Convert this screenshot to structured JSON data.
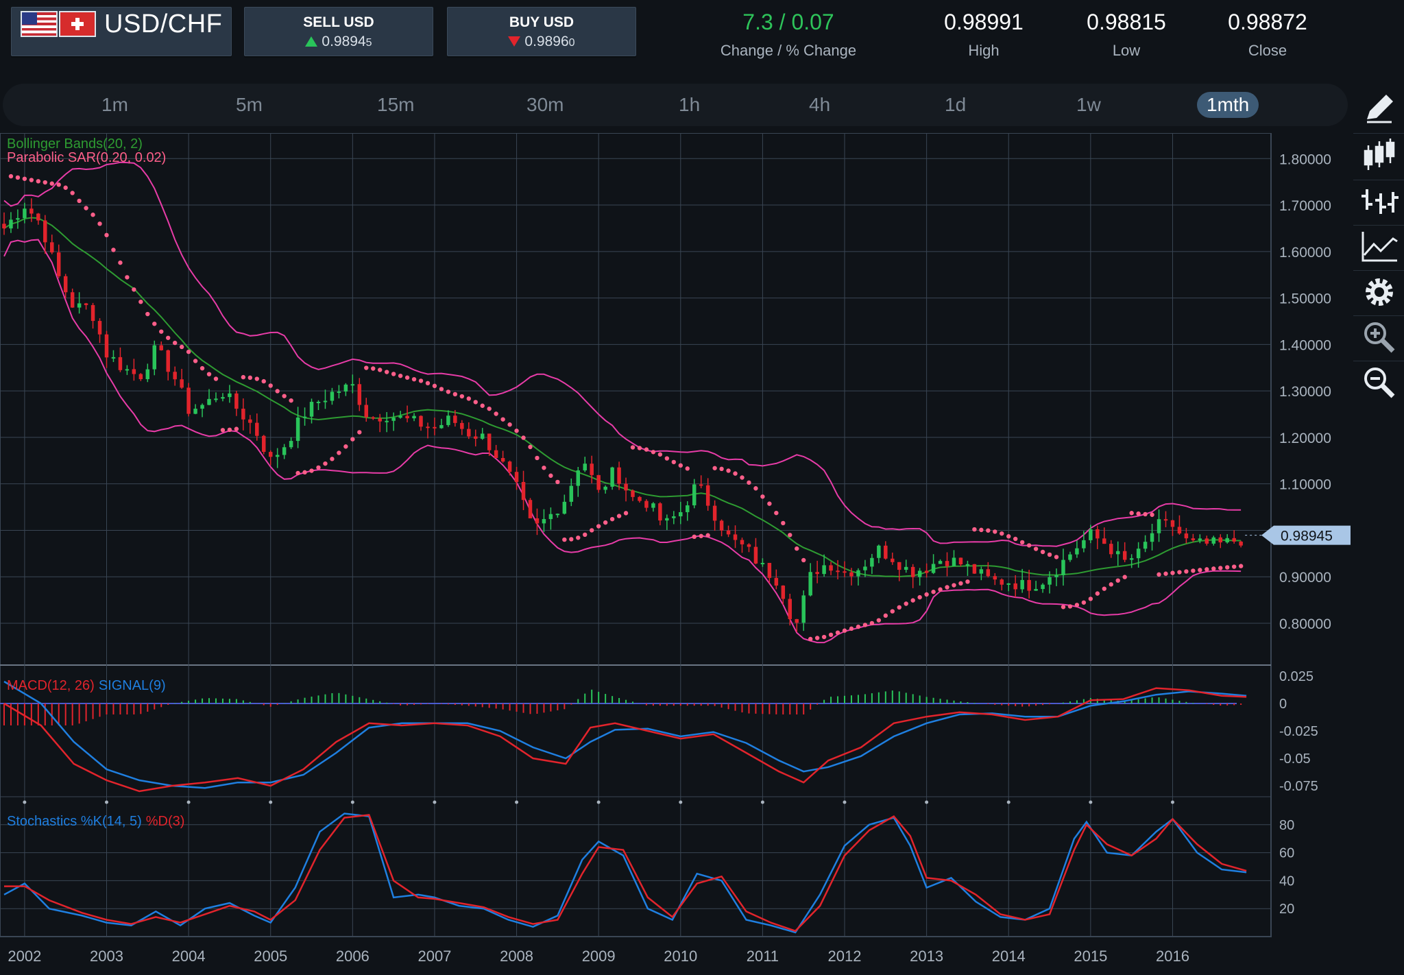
{
  "header": {
    "pair": "USD/CHF",
    "sell": {
      "label": "SELL USD",
      "price_main": "0.9894",
      "price_pip": "5",
      "direction": "up"
    },
    "buy": {
      "label": "BUY USD",
      "price_main": "0.9896",
      "price_pip": "0",
      "direction": "down"
    },
    "stats": [
      {
        "value": "7.3 / 0.07",
        "label": "Change / % Change",
        "color": "#2ec45a"
      },
      {
        "value": "0.98991",
        "label": "High"
      },
      {
        "value": "0.98815",
        "label": "Low"
      },
      {
        "value": "0.98872",
        "label": "Close"
      }
    ]
  },
  "timeframes": [
    "1m",
    "5m",
    "15m",
    "30m",
    "1h",
    "4h",
    "1d",
    "1w",
    "1mth"
  ],
  "active_timeframe": "1mth",
  "toolbar": [
    "pencil-icon",
    "candlestick-icon",
    "ohlc-bars-icon",
    "line-chart-icon",
    "gear-icon",
    "zoom-in-icon",
    "zoom-out-icon"
  ],
  "colors": {
    "up": "#29c45a",
    "down": "#e2242c",
    "bollinger_mid": "#2e9c32",
    "bollinger_band": "#e83ca8",
    "sar": "#ff5f8a",
    "macd": "#e2242c",
    "signal": "#1f7fe0",
    "grid": "#3a4654",
    "price_tag": "#a9c6e6"
  },
  "chart_data": {
    "type": "candlestick",
    "x_ticks": [
      "2002",
      "2003",
      "2004",
      "2005",
      "2006",
      "2007",
      "2008",
      "2009",
      "2010",
      "2011",
      "2012",
      "2013",
      "2014",
      "2015",
      "2016"
    ],
    "x_range": [
      2001.7,
      2017.2
    ],
    "price_panel": {
      "y_ticks": [
        "1.80000",
        "1.70000",
        "1.60000",
        "1.50000",
        "1.40000",
        "1.30000",
        "1.20000",
        "1.10000",
        "1.00000",
        "0.90000",
        "0.80000"
      ],
      "y_range": [
        0.71,
        1.855
      ],
      "indicators": [
        "Bollinger Bands(20, 2)",
        "Parabolic SAR(0.20, 0.02)"
      ],
      "current_price": "0.98945",
      "close_series": [
        [
          2001.75,
          1.65
        ],
        [
          2002.0,
          1.7
        ],
        [
          2002.2,
          1.66
        ],
        [
          2002.4,
          1.55
        ],
        [
          2002.6,
          1.48
        ],
        [
          2002.8,
          1.48
        ],
        [
          2003.0,
          1.38
        ],
        [
          2003.2,
          1.35
        ],
        [
          2003.4,
          1.33
        ],
        [
          2003.6,
          1.39
        ],
        [
          2003.8,
          1.34
        ],
        [
          2004.0,
          1.26
        ],
        [
          2004.2,
          1.27
        ],
        [
          2004.4,
          1.3
        ],
        [
          2004.6,
          1.26
        ],
        [
          2004.8,
          1.22
        ],
        [
          2005.0,
          1.15
        ],
        [
          2005.2,
          1.19
        ],
        [
          2005.4,
          1.25
        ],
        [
          2005.6,
          1.28
        ],
        [
          2005.8,
          1.3
        ],
        [
          2006.0,
          1.31
        ],
        [
          2006.2,
          1.24
        ],
        [
          2006.4,
          1.25
        ],
        [
          2006.6,
          1.24
        ],
        [
          2006.8,
          1.23
        ],
        [
          2007.0,
          1.22
        ],
        [
          2007.2,
          1.24
        ],
        [
          2007.4,
          1.21
        ],
        [
          2007.6,
          1.2
        ],
        [
          2007.8,
          1.15
        ],
        [
          2008.0,
          1.09
        ],
        [
          2008.2,
          1.0
        ],
        [
          2008.4,
          1.03
        ],
        [
          2008.6,
          1.07
        ],
        [
          2008.8,
          1.16
        ],
        [
          2009.0,
          1.08
        ],
        [
          2009.2,
          1.13
        ],
        [
          2009.4,
          1.07
        ],
        [
          2009.6,
          1.06
        ],
        [
          2009.8,
          1.01
        ],
        [
          2010.0,
          1.04
        ],
        [
          2010.2,
          1.1
        ],
        [
          2010.4,
          1.04
        ],
        [
          2010.6,
          0.98
        ],
        [
          2010.8,
          0.96
        ],
        [
          2011.0,
          0.92
        ],
        [
          2011.2,
          0.89
        ],
        [
          2011.4,
          0.79
        ],
        [
          2011.6,
          0.91
        ],
        [
          2011.8,
          0.93
        ],
        [
          2012.0,
          0.91
        ],
        [
          2012.2,
          0.92
        ],
        [
          2012.4,
          0.96
        ],
        [
          2012.6,
          0.94
        ],
        [
          2012.8,
          0.91
        ],
        [
          2013.0,
          0.92
        ],
        [
          2013.2,
          0.94
        ],
        [
          2013.4,
          0.93
        ],
        [
          2013.6,
          0.91
        ],
        [
          2013.8,
          0.89
        ],
        [
          2014.0,
          0.89
        ],
        [
          2014.2,
          0.88
        ],
        [
          2014.4,
          0.89
        ],
        [
          2014.6,
          0.92
        ],
        [
          2014.8,
          0.96
        ],
        [
          2015.0,
          0.99
        ],
        [
          2015.2,
          0.97
        ],
        [
          2015.4,
          0.93
        ],
        [
          2015.6,
          0.95
        ],
        [
          2015.8,
          1.01
        ],
        [
          2016.0,
          1.01
        ],
        [
          2016.2,
          0.97
        ],
        [
          2016.4,
          0.97
        ],
        [
          2016.6,
          0.97
        ],
        [
          2016.8,
          0.98
        ],
        [
          2016.9,
          0.98
        ]
      ]
    },
    "macd_panel": {
      "label_macd": "MACD(12, 26)",
      "label_signal": "SIGNAL(9)",
      "y_ticks": [
        "0.025",
        "0",
        "-0.025",
        "-0.05",
        "-0.075"
      ],
      "y_range": [
        -0.085,
        0.035
      ],
      "macd_series": [
        [
          2001.75,
          0.0
        ],
        [
          2002.2,
          -0.02
        ],
        [
          2002.6,
          -0.055
        ],
        [
          2003.0,
          -0.07
        ],
        [
          2003.4,
          -0.08
        ],
        [
          2003.8,
          -0.075
        ],
        [
          2004.2,
          -0.072
        ],
        [
          2004.6,
          -0.068
        ],
        [
          2005.0,
          -0.075
        ],
        [
          2005.4,
          -0.06
        ],
        [
          2005.8,
          -0.035
        ],
        [
          2006.2,
          -0.018
        ],
        [
          2006.6,
          -0.02
        ],
        [
          2007.0,
          -0.018
        ],
        [
          2007.4,
          -0.02
        ],
        [
          2007.8,
          -0.03
        ],
        [
          2008.2,
          -0.05
        ],
        [
          2008.6,
          -0.055
        ],
        [
          2008.9,
          -0.022
        ],
        [
          2009.2,
          -0.018
        ],
        [
          2009.6,
          -0.025
        ],
        [
          2010.0,
          -0.032
        ],
        [
          2010.4,
          -0.028
        ],
        [
          2010.8,
          -0.045
        ],
        [
          2011.2,
          -0.062
        ],
        [
          2011.5,
          -0.072
        ],
        [
          2011.8,
          -0.052
        ],
        [
          2012.2,
          -0.04
        ],
        [
          2012.6,
          -0.018
        ],
        [
          2013.0,
          -0.012
        ],
        [
          2013.4,
          -0.008
        ],
        [
          2013.8,
          -0.01
        ],
        [
          2014.2,
          -0.015
        ],
        [
          2014.6,
          -0.012
        ],
        [
          2015.0,
          0.003
        ],
        [
          2015.4,
          0.004
        ],
        [
          2015.8,
          0.014
        ],
        [
          2016.2,
          0.012
        ],
        [
          2016.6,
          0.007
        ],
        [
          2016.9,
          0.006
        ]
      ],
      "signal_series": [
        [
          2001.75,
          0.02
        ],
        [
          2002.2,
          0.0
        ],
        [
          2002.6,
          -0.035
        ],
        [
          2003.0,
          -0.06
        ],
        [
          2003.4,
          -0.07
        ],
        [
          2003.8,
          -0.075
        ],
        [
          2004.2,
          -0.077
        ],
        [
          2004.6,
          -0.072
        ],
        [
          2005.0,
          -0.072
        ],
        [
          2005.4,
          -0.065
        ],
        [
          2005.8,
          -0.045
        ],
        [
          2006.2,
          -0.022
        ],
        [
          2006.6,
          -0.018
        ],
        [
          2007.0,
          -0.018
        ],
        [
          2007.4,
          -0.018
        ],
        [
          2007.8,
          -0.025
        ],
        [
          2008.2,
          -0.04
        ],
        [
          2008.6,
          -0.05
        ],
        [
          2008.9,
          -0.035
        ],
        [
          2009.2,
          -0.024
        ],
        [
          2009.6,
          -0.023
        ],
        [
          2010.0,
          -0.03
        ],
        [
          2010.4,
          -0.026
        ],
        [
          2010.8,
          -0.036
        ],
        [
          2011.2,
          -0.052
        ],
        [
          2011.5,
          -0.062
        ],
        [
          2011.8,
          -0.058
        ],
        [
          2012.2,
          -0.048
        ],
        [
          2012.6,
          -0.03
        ],
        [
          2013.0,
          -0.018
        ],
        [
          2013.4,
          -0.01
        ],
        [
          2013.8,
          -0.009
        ],
        [
          2014.2,
          -0.012
        ],
        [
          2014.6,
          -0.012
        ],
        [
          2015.0,
          -0.002
        ],
        [
          2015.4,
          0.002
        ],
        [
          2015.8,
          0.008
        ],
        [
          2016.2,
          0.011
        ],
        [
          2016.6,
          0.009
        ],
        [
          2016.9,
          0.007
        ]
      ]
    },
    "stoch_panel": {
      "label_k": "Stochastics %K(14, 5)",
      "label_d": "%D(3)",
      "y_ticks": [
        "80",
        "60",
        "40",
        "20"
      ],
      "y_range": [
        0,
        100
      ],
      "k_series": [
        [
          2001.75,
          30
        ],
        [
          2002.0,
          38
        ],
        [
          2002.3,
          20
        ],
        [
          2002.7,
          15
        ],
        [
          2003.0,
          10
        ],
        [
          2003.3,
          8
        ],
        [
          2003.6,
          18
        ],
        [
          2003.9,
          8
        ],
        [
          2004.2,
          20
        ],
        [
          2004.5,
          24
        ],
        [
          2004.8,
          15
        ],
        [
          2005.0,
          10
        ],
        [
          2005.3,
          35
        ],
        [
          2005.6,
          75
        ],
        [
          2005.9,
          88
        ],
        [
          2006.2,
          86
        ],
        [
          2006.5,
          28
        ],
        [
          2006.8,
          30
        ],
        [
          2007.0,
          28
        ],
        [
          2007.3,
          22
        ],
        [
          2007.6,
          20
        ],
        [
          2007.9,
          12
        ],
        [
          2008.2,
          7
        ],
        [
          2008.5,
          15
        ],
        [
          2008.8,
          55
        ],
        [
          2009.0,
          68
        ],
        [
          2009.3,
          58
        ],
        [
          2009.6,
          20
        ],
        [
          2009.9,
          12
        ],
        [
          2010.2,
          45
        ],
        [
          2010.5,
          40
        ],
        [
          2010.8,
          12
        ],
        [
          2011.1,
          8
        ],
        [
          2011.4,
          3
        ],
        [
          2011.7,
          30
        ],
        [
          2012.0,
          65
        ],
        [
          2012.3,
          80
        ],
        [
          2012.6,
          85
        ],
        [
          2012.8,
          65
        ],
        [
          2013.0,
          35
        ],
        [
          2013.3,
          42
        ],
        [
          2013.6,
          25
        ],
        [
          2013.9,
          14
        ],
        [
          2014.2,
          12
        ],
        [
          2014.5,
          20
        ],
        [
          2014.8,
          70
        ],
        [
          2014.95,
          82
        ],
        [
          2015.2,
          60
        ],
        [
          2015.5,
          58
        ],
        [
          2015.8,
          75
        ],
        [
          2016.0,
          84
        ],
        [
          2016.3,
          60
        ],
        [
          2016.6,
          48
        ],
        [
          2016.9,
          46
        ]
      ],
      "d_series": [
        [
          2001.75,
          36
        ],
        [
          2002.0,
          36
        ],
        [
          2002.3,
          26
        ],
        [
          2002.7,
          17
        ],
        [
          2003.0,
          12
        ],
        [
          2003.3,
          9
        ],
        [
          2003.6,
          14
        ],
        [
          2003.9,
          10
        ],
        [
          2004.2,
          16
        ],
        [
          2004.5,
          22
        ],
        [
          2004.8,
          18
        ],
        [
          2005.0,
          12
        ],
        [
          2005.3,
          26
        ],
        [
          2005.6,
          62
        ],
        [
          2005.9,
          85
        ],
        [
          2006.2,
          87
        ],
        [
          2006.5,
          40
        ],
        [
          2006.8,
          28
        ],
        [
          2007.0,
          27
        ],
        [
          2007.3,
          24
        ],
        [
          2007.6,
          21
        ],
        [
          2007.9,
          14
        ],
        [
          2008.2,
          9
        ],
        [
          2008.5,
          12
        ],
        [
          2008.8,
          45
        ],
        [
          2009.0,
          64
        ],
        [
          2009.3,
          62
        ],
        [
          2009.6,
          28
        ],
        [
          2009.9,
          14
        ],
        [
          2010.2,
          38
        ],
        [
          2010.5,
          43
        ],
        [
          2010.8,
          18
        ],
        [
          2011.1,
          10
        ],
        [
          2011.4,
          4
        ],
        [
          2011.7,
          22
        ],
        [
          2012.0,
          58
        ],
        [
          2012.3,
          76
        ],
        [
          2012.6,
          86
        ],
        [
          2012.8,
          72
        ],
        [
          2013.0,
          42
        ],
        [
          2013.3,
          40
        ],
        [
          2013.6,
          30
        ],
        [
          2013.9,
          16
        ],
        [
          2014.2,
          12
        ],
        [
          2014.5,
          16
        ],
        [
          2014.8,
          62
        ],
        [
          2014.95,
          80
        ],
        [
          2015.2,
          66
        ],
        [
          2015.5,
          58
        ],
        [
          2015.8,
          70
        ],
        [
          2016.0,
          84
        ],
        [
          2016.3,
          66
        ],
        [
          2016.6,
          52
        ],
        [
          2016.9,
          47
        ]
      ]
    }
  }
}
